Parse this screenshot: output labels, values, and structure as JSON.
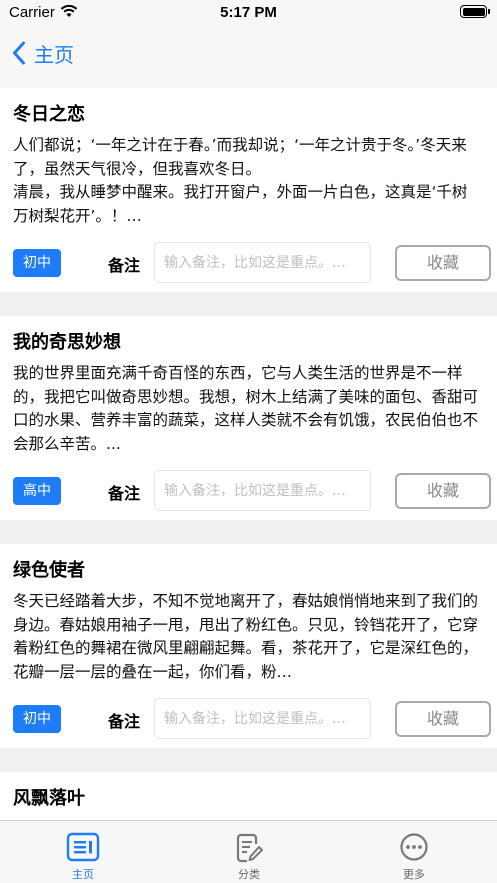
{
  "status_bar": {
    "carrier": "Carrier",
    "time": "5:17 PM"
  },
  "nav": {
    "back_label": "主页"
  },
  "accent_color": "#1e7cf6",
  "articles": [
    {
      "title": "冬日之恋",
      "excerpt": "人们都说；‘一年之计在于春。’而我却说；‘一年之计贵于冬。’冬天来了，虽然天气很冷，但我喜欢冬日。\n清晨，我从睡梦中醒来。我打开窗户，外面一片白色，这真是‘千树万树梨花开’。！…",
      "grade": "初中",
      "note_label": "备注",
      "note_placeholder": "输入备注，比如这是重点。…",
      "favorite_label": "收藏"
    },
    {
      "title": "我的奇思妙想",
      "excerpt": "我的世界里面充满千奇百怪的东西，它与人类生活的世界是不一样的，我把它叫做奇思妙想。我想，树木上结满了美味的面包、香甜可口的水果、营养丰富的蔬菜，这样人类就不会有饥饿，农民伯伯也不会那么辛苦。...",
      "grade": "高中",
      "note_label": "备注",
      "note_placeholder": "输入备注，比如这是重点。…",
      "favorite_label": "收藏"
    },
    {
      "title": "绿色使者",
      "excerpt": "冬天已经踏着大步，不知不觉地离开了，春姑娘悄悄地来到了我们的身边。春姑娘用袖子一甩，甩出了粉红色。只见，铃铛花开了，它穿着粉红色的舞裙在微风里翩翩起舞。看，茶花开了，它是深红色的，花瓣一层一层的叠在一起，你们看，粉…",
      "grade": "初中",
      "note_label": "备注",
      "note_placeholder": "输入备注，比如这是重点。…",
      "favorite_label": "收藏"
    },
    {
      "title": "风飘落叶",
      "excerpt": "",
      "grade": "",
      "note_label": "",
      "note_placeholder": "",
      "favorite_label": ""
    }
  ],
  "tabs": [
    {
      "label": "主页",
      "icon": "list-icon",
      "active": true
    },
    {
      "label": "分类",
      "icon": "edit-doc-icon",
      "active": false
    },
    {
      "label": "更多",
      "icon": "more-icon",
      "active": false
    }
  ]
}
